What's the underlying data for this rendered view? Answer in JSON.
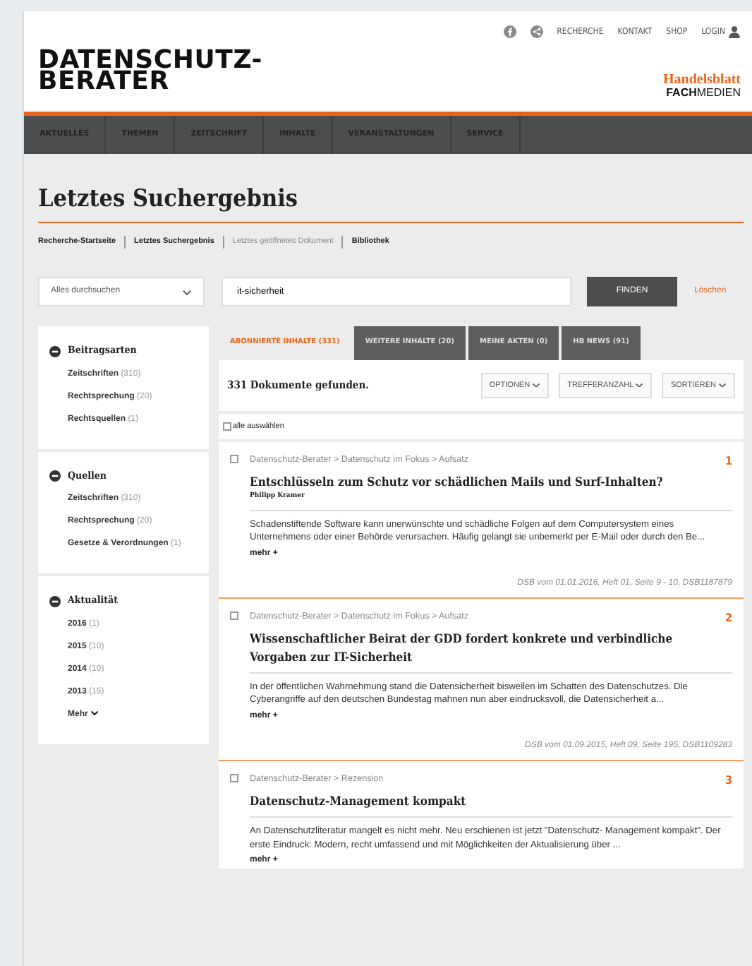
{
  "top_links": [
    "RECHERCHE",
    "KONTAKT",
    "SHOP",
    "LOGIN"
  ],
  "logo": {
    "line1": "DATENSCHUTZ-",
    "line2": "BERATER"
  },
  "publisher": {
    "line1": "Handelsblatt",
    "line2_bold": "FACH",
    "line2_rest": "MEDIEN"
  },
  "nav": [
    "AKTUELLES",
    "THEMEN",
    "ZEITSCHRIFT",
    "INHALTE",
    "VERANSTALTUNGEN",
    "SERVICE"
  ],
  "page_title": "Letztes Suchergebnis",
  "breadcrumbs": [
    {
      "label": "Recherche-Startseite",
      "disabled": false
    },
    {
      "label": "Letztes Suchergebnis",
      "disabled": false
    },
    {
      "label": "Letztes geöffnetes Dokument",
      "disabled": true
    },
    {
      "label": "Bibliothek",
      "disabled": false
    }
  ],
  "search": {
    "scope": "Alles durchsuchen",
    "value": "it-sicherheit",
    "button": "FINDEN",
    "clear": "Löschen"
  },
  "filters": [
    {
      "title": "Beitragsarten",
      "expanded": true,
      "items": [
        {
          "label": "Zeitschriften",
          "count": "(310)"
        },
        {
          "label": "Rechtsprechung",
          "count": "(20)"
        },
        {
          "label": "Rechtsquellen",
          "count": "(1)"
        }
      ]
    },
    {
      "title": "Quellen",
      "expanded": true,
      "items": [
        {
          "label": "Zeitschriften",
          "count": "(310)"
        },
        {
          "label": "Rechtsprechung",
          "count": "(20)"
        },
        {
          "label": "Gesetze & Verordnungen",
          "count": "(1)"
        }
      ]
    },
    {
      "title": "Aktualität",
      "expanded": true,
      "items": [
        {
          "label": "2016",
          "count": "(1)"
        },
        {
          "label": "2015",
          "count": "(10)"
        },
        {
          "label": "2014",
          "count": "(10)"
        },
        {
          "label": "2013",
          "count": "(15)"
        }
      ],
      "more": "Mehr"
    }
  ],
  "tabs": [
    {
      "label": "ABONNIERTE INHALTE (331)",
      "selected": true
    },
    {
      "label": "WEITERE INHALTE (20)",
      "selected": false
    },
    {
      "label": "MEINE AKTEN (0)",
      "selected": false
    },
    {
      "label": "HB NEWS (91)",
      "selected": false
    }
  ],
  "result_count": "331 Dokumente gefunden.",
  "toolbar": [
    "OPTIONEN",
    "TREFFERANZAHL",
    "SORTIEREN"
  ],
  "select_all": {
    "label": "alle auswählen",
    "checked": false
  },
  "results": [
    {
      "checked": false,
      "path": "Datenschutz-Berater > Datenschutz im Fokus > Aufsatz",
      "number": "1",
      "title": "Entschlüsseln zum Schutz vor schädlichen Mails und Surf-Inhalten?",
      "author": "Philipp Kramer",
      "snippet": "Schadenstiftende Software kann unerwünschte und schädliche Folgen auf dem Computersystem eines Unternehmens oder einer Behörde verursachen. Häufig gelangt sie unbemerkt per E-Mail oder durch den Be...",
      "more": "mehr +",
      "source": "DSB vom 01.01.2016, Heft 01, Seite 9 - 10, DSB1187879"
    },
    {
      "checked": false,
      "path": "Datenschutz-Berater > Datenschutz im Fokus > Aufsatz",
      "number": "2",
      "title": "Wissenschaftlicher Beirat der GDD fordert konkrete und verbindliche Vorgaben zur IT-Sicherheit",
      "snippet": "In der öffentlichen Wahrnehmung stand die Datensicherheit bisweilen im Schatten des Datenschutzes. Die Cyberangriffe auf den deutschen Bundestag mahnen nun aber eindrucksvoll, die Datensicherheit a...",
      "more": "mehr +",
      "source": "DSB vom 01.09.2015, Heft 09, Seite 195, DSB1109283"
    },
    {
      "checked": false,
      "path": "Datenschutz-Berater > Rezension",
      "number": "3",
      "title": "Datenschutz-Management kompakt",
      "snippet": "An Datenschutzliteratur mangelt es nicht mehr. Neu erschienen ist jetzt \"Datenschutz- Management kompakt\". Der erste Eindruck: Modern, recht umfassend und mit Möglichkeiten der Aktualisierung über ...",
      "more": "mehr +"
    }
  ]
}
